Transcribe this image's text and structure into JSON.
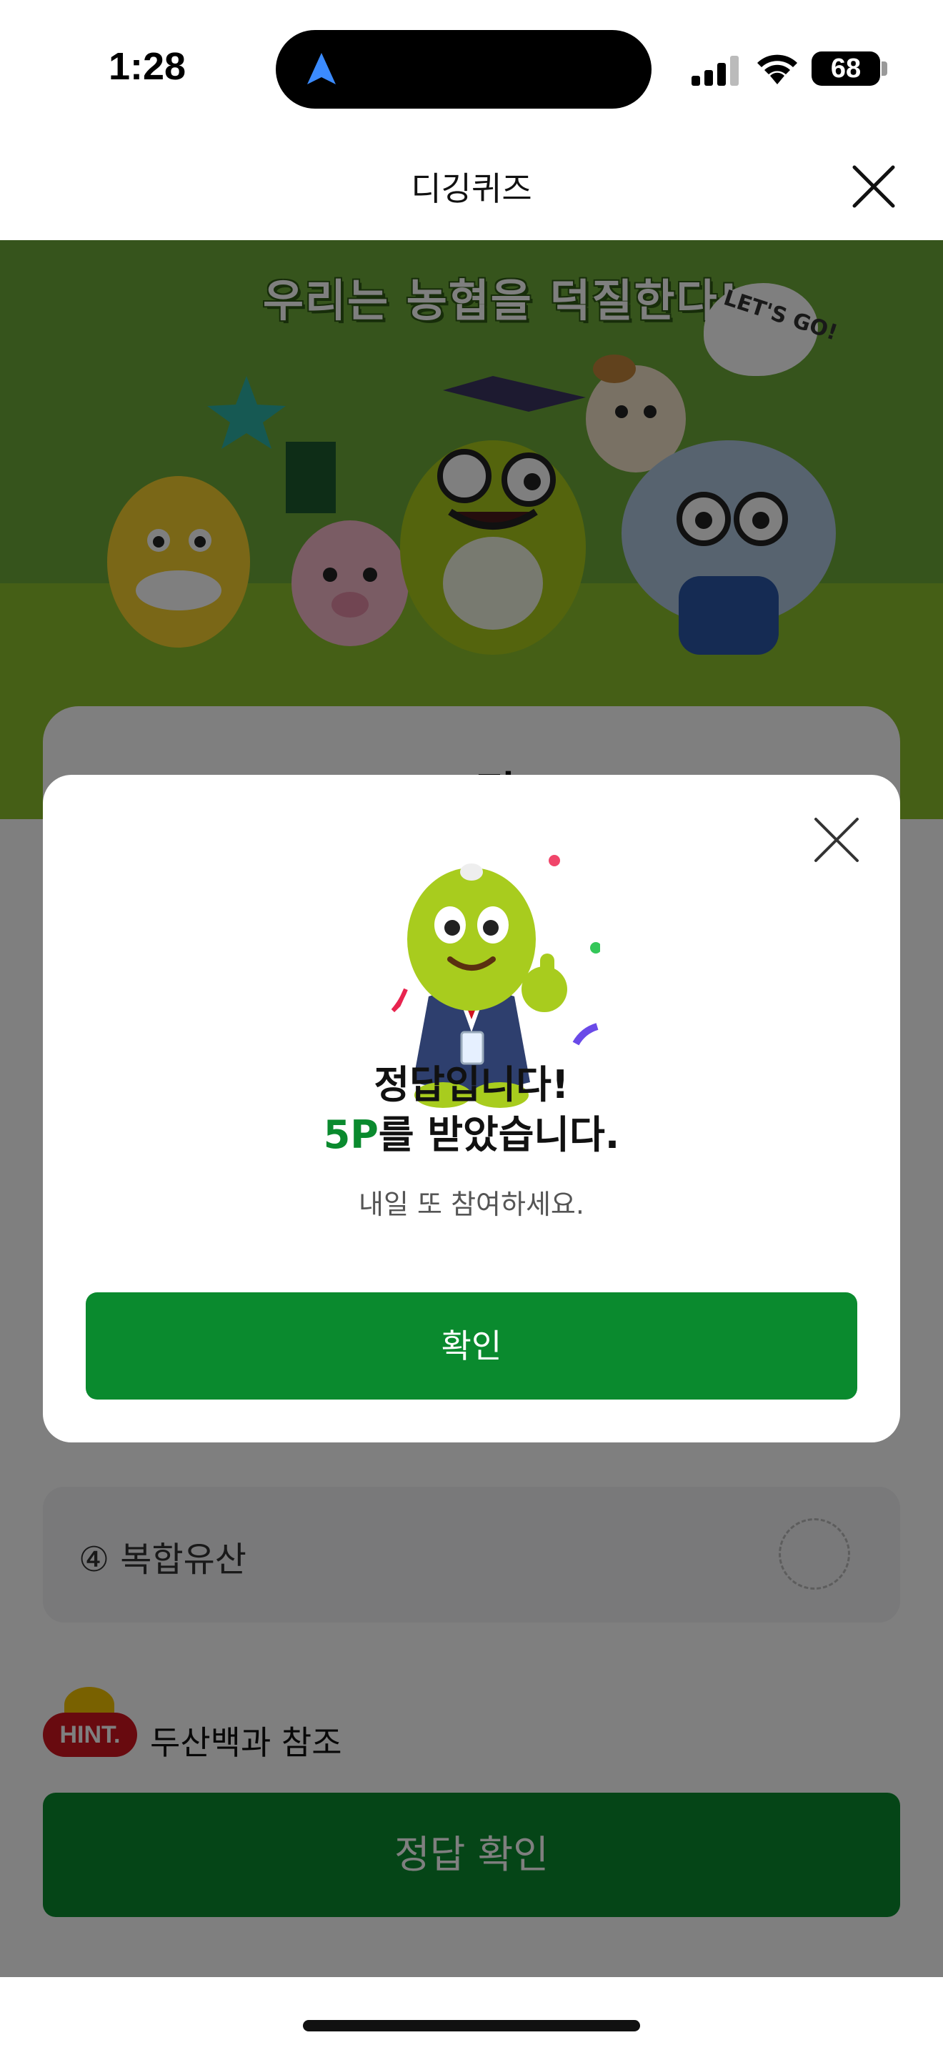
{
  "status_bar": {
    "time": "1:28",
    "battery": "68",
    "battery_level": 0.68
  },
  "header": {
    "title": "디깅퀴즈"
  },
  "banner": {
    "slogan": "우리는 농협을 덕질한다!",
    "speech_bubble": "LET'S GO!"
  },
  "quiz": {
    "card_title": "OX 퀴즈",
    "option_4": "④ 복합유산",
    "hint_badge": "HINT.",
    "hint_text": "두산백과 참조",
    "submit_label": "정답 확인"
  },
  "modal": {
    "title": "정답입니다!",
    "points_value": "5P",
    "points_suffix": "를 받았습니다.",
    "subtitle": "내일 또 참여하세요.",
    "confirm_label": "확인"
  },
  "colors": {
    "brand_green": "#0a8a2e",
    "banner_green": "#6da938",
    "hint_red": "#d0141f"
  }
}
